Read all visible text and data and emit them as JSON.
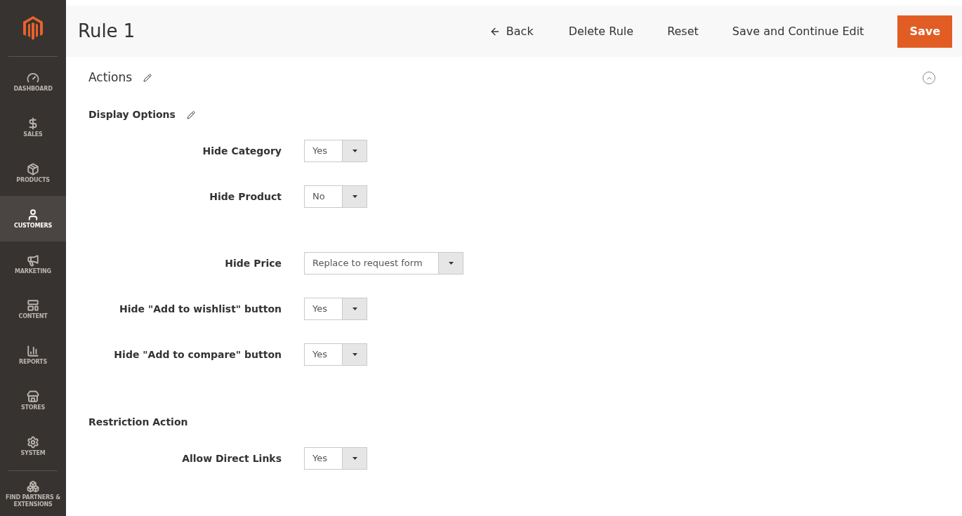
{
  "sidebar": {
    "items": [
      {
        "label": "DASHBOARD",
        "selected": false
      },
      {
        "label": "SALES",
        "selected": false
      },
      {
        "label": "PRODUCTS",
        "selected": false
      },
      {
        "label": "CUSTOMERS",
        "selected": true
      },
      {
        "label": "MARKETING",
        "selected": false
      },
      {
        "label": "CONTENT",
        "selected": false
      },
      {
        "label": "REPORTS",
        "selected": false
      },
      {
        "label": "STORES",
        "selected": false
      },
      {
        "label": "SYSTEM",
        "selected": false
      },
      {
        "label": "FIND PARTNERS & EXTENSIONS",
        "selected": false
      }
    ]
  },
  "header": {
    "title": "Rule 1",
    "actions": [
      {
        "label": "Back",
        "kind": "back"
      },
      {
        "label": "Delete Rule",
        "kind": "plain"
      },
      {
        "label": "Reset",
        "kind": "plain"
      },
      {
        "label": "Save and Continue Edit",
        "kind": "plain"
      },
      {
        "label": "Save",
        "kind": "primary"
      }
    ]
  },
  "section": {
    "title": "Actions",
    "expanded": true
  },
  "display_options": {
    "title": "Display Options",
    "groups": [
      [
        {
          "label": "Hide Category",
          "value": "Yes"
        },
        {
          "label": "Hide Product",
          "value": "No"
        }
      ],
      [
        {
          "label": "Hide Price",
          "value": "Replace to request form"
        },
        {
          "label": "Hide \"Add to wishlist\" button",
          "value": "Yes"
        },
        {
          "label": "Hide \"Add to compare\" button",
          "value": "Yes"
        }
      ]
    ]
  },
  "restriction": {
    "title": "Restriction Action",
    "fields": [
      {
        "label": "Allow Direct Links",
        "value": "Yes"
      }
    ]
  }
}
